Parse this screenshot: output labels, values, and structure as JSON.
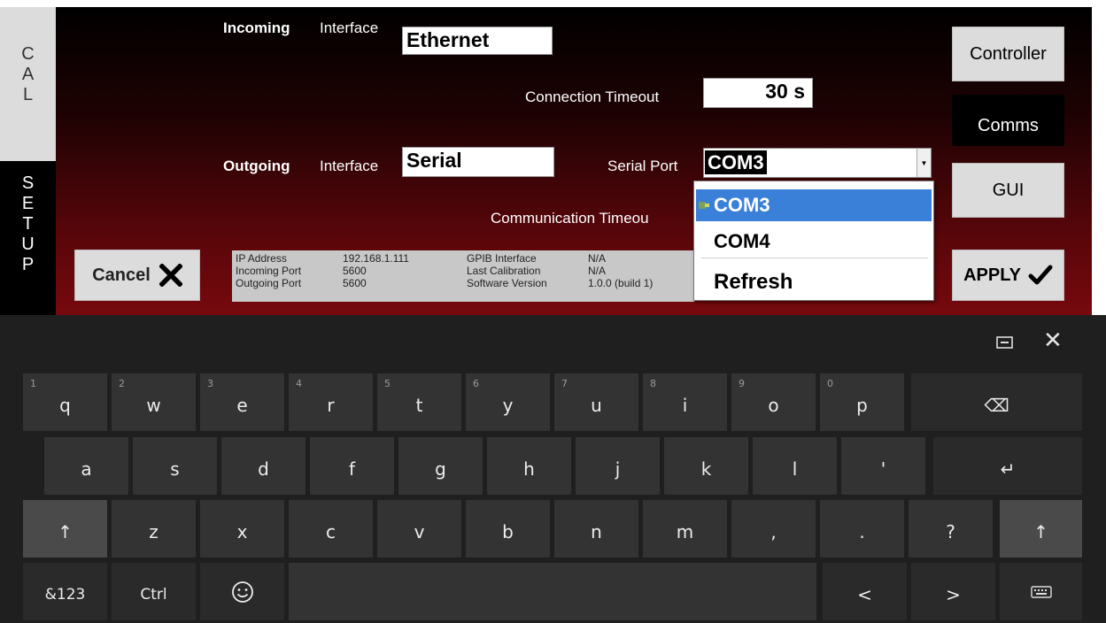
{
  "tabs": {
    "cal": [
      "C",
      "A",
      "L"
    ],
    "setup": [
      "S",
      "E",
      "T",
      "U",
      "P"
    ]
  },
  "incoming": {
    "label": "Incoming",
    "interface_label": "Interface",
    "interface_value": "Ethernet"
  },
  "connection_timeout": {
    "label": "Connection Timeout",
    "value": "30 s"
  },
  "outgoing": {
    "label": "Outgoing",
    "interface_label": "Interface",
    "interface_value": "Serial"
  },
  "serial_port": {
    "label": "Serial Port",
    "value": "COM3",
    "options": [
      "COM3",
      "COM4",
      "Refresh"
    ],
    "selected_index": 0
  },
  "communication_timeout": {
    "label": "Communication Timeou"
  },
  "info": {
    "ip_address_label": "IP Address",
    "ip_address": "192.168.1.111",
    "incoming_port_label": "Incoming Port",
    "incoming_port": "5600",
    "outgoing_port_label": "Outgoing Port",
    "outgoing_port": "5600",
    "gpib_label": "GPIB Interface",
    "gpib": "N/A",
    "calibration_label": "Last Calibration",
    "calibration": "N/A",
    "software_label": "Software Version",
    "software": "1.0.0 (build 1)"
  },
  "buttons": {
    "cancel": "Cancel",
    "apply": "APPLY",
    "controller": "Controller",
    "comms": "Comms",
    "gui": "GUI"
  },
  "keyboard": {
    "row1": [
      {
        "k": "q",
        "n": "1"
      },
      {
        "k": "w",
        "n": "2"
      },
      {
        "k": "e",
        "n": "3"
      },
      {
        "k": "r",
        "n": "4"
      },
      {
        "k": "t",
        "n": "5"
      },
      {
        "k": "y",
        "n": "6"
      },
      {
        "k": "u",
        "n": "7"
      },
      {
        "k": "i",
        "n": "8"
      },
      {
        "k": "o",
        "n": "9"
      },
      {
        "k": "p",
        "n": "0"
      }
    ],
    "row2": [
      "a",
      "s",
      "d",
      "f",
      "g",
      "h",
      "j",
      "k",
      "l",
      "'"
    ],
    "row3": [
      "z",
      "x",
      "c",
      "v",
      "b",
      "n",
      "m",
      ",",
      ".",
      "?"
    ],
    "symbols_key": "&123",
    "ctrl_key": "Ctrl",
    "backspace_glyph": "⌫",
    "enter_glyph": "↵",
    "shift_glyph": "↑",
    "left_glyph": "<",
    "right_glyph": ">",
    "close_glyph": "✕"
  },
  "colors": {
    "selection": "#3a7fd8",
    "panel_gradient_bottom": "#76090e",
    "keyboard_bg": "#1f1f1f"
  }
}
